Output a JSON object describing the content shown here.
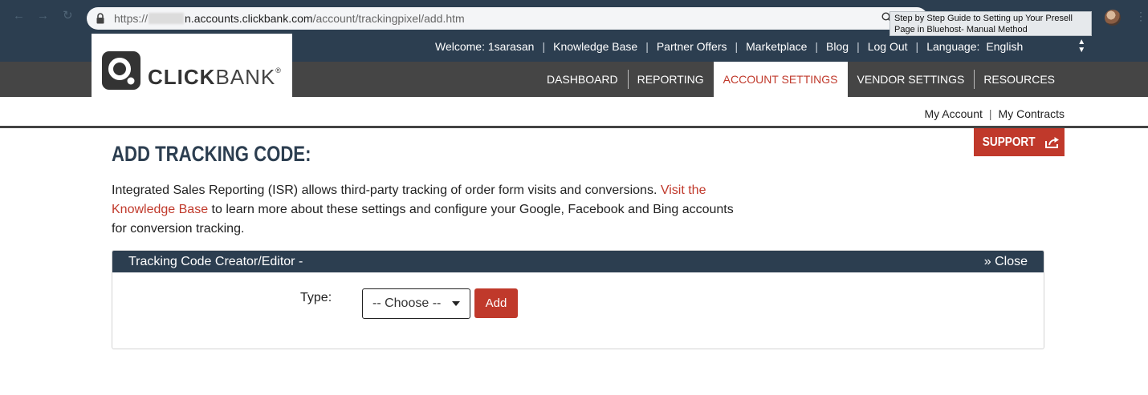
{
  "browser": {
    "url": {
      "scheme": "https://",
      "host": "n.accounts.clickbank.com",
      "path": "/account/trackingpixel/add.htm"
    },
    "tooltip": {
      "line1": "Step by Step Guide to Setting up Your Presell",
      "line2": "Page in Bluehost- Manual Method"
    }
  },
  "header": {
    "top_links": {
      "welcome": "Welcome: 1sarasan",
      "knowledge_base": "Knowledge Base",
      "partner_offers": "Partner Offers",
      "marketplace": "Marketplace",
      "blog": "Blog",
      "logout": "Log Out",
      "language_label": "Language:",
      "language_value": "English"
    },
    "logo": {
      "bold": "CLICK",
      "light": "BANK",
      "mark": "®"
    },
    "nav": [
      {
        "label": "DASHBOARD",
        "active": false
      },
      {
        "label": "REPORTING",
        "active": false
      },
      {
        "label": "ACCOUNT SETTINGS",
        "active": true
      },
      {
        "label": "VENDOR SETTINGS",
        "active": false
      },
      {
        "label": "RESOURCES",
        "active": false
      }
    ],
    "subnav": {
      "my_account": "My Account",
      "my_contracts": "My Contracts"
    }
  },
  "main": {
    "support_label": "SUPPORT",
    "title": "ADD TRACKING CODE:",
    "intro": {
      "text_before": "Integrated Sales Reporting (ISR) allows third-party tracking of order form visits and conversions. ",
      "link": "Visit the Knowledge Base",
      "text_after": " to learn more about these settings and configure your Google, Facebook and Bing accounts for conversion tracking."
    },
    "panel": {
      "title": "Tracking Code Creator/Editor -",
      "close_label": "» Close",
      "type_label": "Type:",
      "type_selected": "-- Choose --",
      "add_label": "Add"
    }
  },
  "colors": {
    "header_dark": "#2c3e50",
    "nav_gray": "#454545",
    "accent_red": "#c0392b"
  }
}
